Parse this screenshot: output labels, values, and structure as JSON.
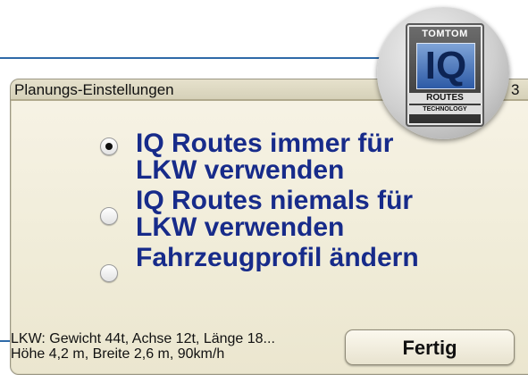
{
  "window": {
    "title": "Planungs-Einstellungen",
    "title_tail": "3"
  },
  "badge": {
    "brand": "TOMTOM",
    "main": "IQ",
    "line1": "ROUTES",
    "line2": "TECHNOLOGY"
  },
  "options": [
    {
      "label": "IQ Routes immer für LKW verwenden",
      "selected": true
    },
    {
      "label": "IQ Routes niemals für LKW verwenden",
      "selected": false
    },
    {
      "label": "Fahrzeugprofil ändern",
      "selected": false
    }
  ],
  "status": {
    "line1": "LKW: Gewicht 44t, Achse 12t, Länge 18...",
    "line2": "Höhe 4,2 m, Breite 2,6 m, 90km/h"
  },
  "buttons": {
    "done": "Fertig"
  },
  "colors": {
    "option_text": "#172b8a",
    "accent_line": "#2f6aa8"
  }
}
